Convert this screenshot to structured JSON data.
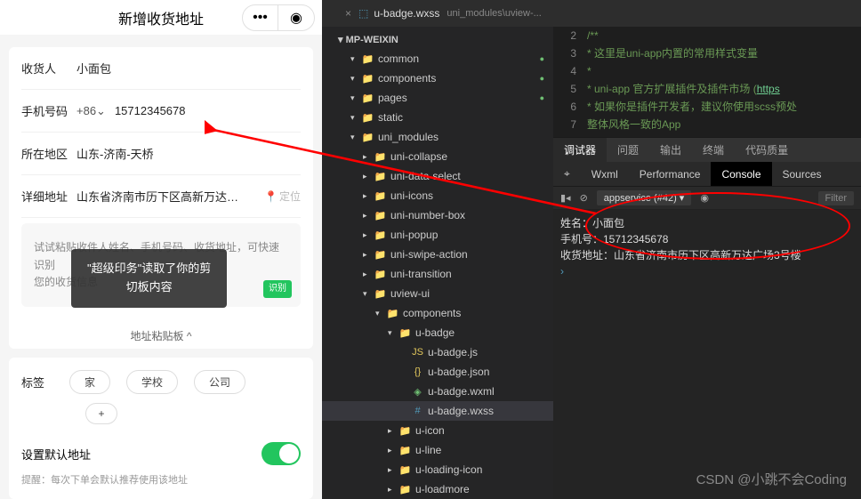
{
  "mobile": {
    "title": "新增收货地址",
    "recipient_label": "收货人",
    "recipient_value": "小面包",
    "phone_label": "手机号码",
    "phone_prefix": "+86⌄",
    "phone_value": "15712345678",
    "region_label": "所在地区",
    "region_value": "山东-济南-天桥",
    "detail_label": "详细地址",
    "detail_value": "山东省济南市历下区高新万达…",
    "locate_label": "定位",
    "panel_text1": "试试粘贴收件人姓名、手机号码、收货地址，可快速识别",
    "panel_text2": "您的收货信息",
    "panel_badge": "识别",
    "clip_board": "地址粘贴板 ^",
    "tags_label": "标签",
    "tags": [
      "家",
      "学校",
      "公司"
    ],
    "tag_plus": "+",
    "default_label": "设置默认地址",
    "hint": "提醒：每次下单会默认推荐使用该地址"
  },
  "toast": {
    "line1": "\"超级印务\"读取了你的剪",
    "line2": "切板内容"
  },
  "ide": {
    "tab_file": "u-badge.wxss",
    "tab_path": "uni_modules\\uview-...",
    "tree_root": "MP-WEIXIN",
    "tree": [
      {
        "depth": 1,
        "open": true,
        "icon": "fold-y",
        "label": "common",
        "dot": true
      },
      {
        "depth": 1,
        "open": true,
        "icon": "fold-y",
        "label": "components",
        "dot": true
      },
      {
        "depth": 1,
        "open": true,
        "icon": "fold-y",
        "label": "pages",
        "dot": true
      },
      {
        "depth": 1,
        "open": true,
        "icon": "fold-y",
        "label": "static"
      },
      {
        "depth": 1,
        "open": true,
        "icon": "fold-b",
        "label": "uni_modules"
      },
      {
        "depth": 2,
        "open": false,
        "icon": "fold-b",
        "label": "uni-collapse"
      },
      {
        "depth": 2,
        "open": false,
        "icon": "fold-b",
        "label": "uni-data-select"
      },
      {
        "depth": 2,
        "open": false,
        "icon": "fold-b",
        "label": "uni-icons"
      },
      {
        "depth": 2,
        "open": false,
        "icon": "fold-b",
        "label": "uni-number-box"
      },
      {
        "depth": 2,
        "open": false,
        "icon": "fold-b",
        "label": "uni-popup"
      },
      {
        "depth": 2,
        "open": false,
        "icon": "fold-b",
        "label": "uni-swipe-action"
      },
      {
        "depth": 2,
        "open": false,
        "icon": "fold-b",
        "label": "uni-transition"
      },
      {
        "depth": 2,
        "open": true,
        "icon": "fold-b",
        "label": "uview-ui"
      },
      {
        "depth": 3,
        "open": true,
        "icon": "fold-y",
        "label": "components"
      },
      {
        "depth": 4,
        "open": true,
        "icon": "fold-b",
        "label": "u-badge"
      },
      {
        "depth": 5,
        "icon": "js",
        "label": "u-badge.js"
      },
      {
        "depth": 5,
        "icon": "json",
        "label": "u-badge.json"
      },
      {
        "depth": 5,
        "icon": "wxml",
        "label": "u-badge.wxml"
      },
      {
        "depth": 5,
        "icon": "wxss",
        "label": "u-badge.wxss",
        "sel": true
      },
      {
        "depth": 4,
        "open": false,
        "icon": "fold-b",
        "label": "u-icon"
      },
      {
        "depth": 4,
        "open": false,
        "icon": "fold-b",
        "label": "u-line"
      },
      {
        "depth": 4,
        "open": false,
        "icon": "fold-b",
        "label": "u-loading-icon"
      },
      {
        "depth": 4,
        "open": false,
        "icon": "fold-b",
        "label": "u-loadmore"
      }
    ]
  },
  "code": {
    "start": 2,
    "lines": [
      "/**",
      " * 这里是uni-app内置的常用样式变量",
      " *",
      " * uni-app 官方扩展插件及插件市场 (https",
      " * 如果你是插件开发者，建议你使用scss预处",
      "   整体风格一致的App"
    ]
  },
  "debugger": {
    "tabs": [
      "调试器",
      "问题",
      "输出",
      "终端",
      "代码质量"
    ],
    "con_tabs": [
      "Wxml",
      "Performance",
      "Console",
      "Sources"
    ],
    "context": "appservice (#42)",
    "filter_placeholder": "Filter",
    "lines": [
      "姓名：小面包",
      "手机号：15712345678",
      "收货地址：山东省济南市历下区高新万达广场3号楼"
    ]
  },
  "watermark": "CSDN @小跳不会Coding"
}
